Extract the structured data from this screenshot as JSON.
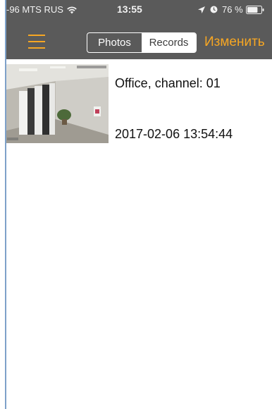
{
  "status_bar": {
    "carrier": "-96 MTS RUS",
    "time": "13:55",
    "battery": "76 %",
    "icons": [
      "wifi-icon",
      "location-icon",
      "clock-icon",
      "battery-icon"
    ],
    "battery_level": 0.76
  },
  "nav": {
    "menu_icon": "hamburger-menu-icon",
    "tabs": [
      {
        "label": "Photos",
        "selected": false
      },
      {
        "label": "Records",
        "selected": true
      }
    ],
    "edit_label": "Изменить"
  },
  "records": [
    {
      "title": "Office, channel: 01",
      "time": "2017-02-06 13:54:44"
    }
  ],
  "colors": {
    "bar_background": "#5a5a5a",
    "accent": "#f6a623",
    "segment_selected": "#ffffff",
    "text_dark": "#111111"
  }
}
